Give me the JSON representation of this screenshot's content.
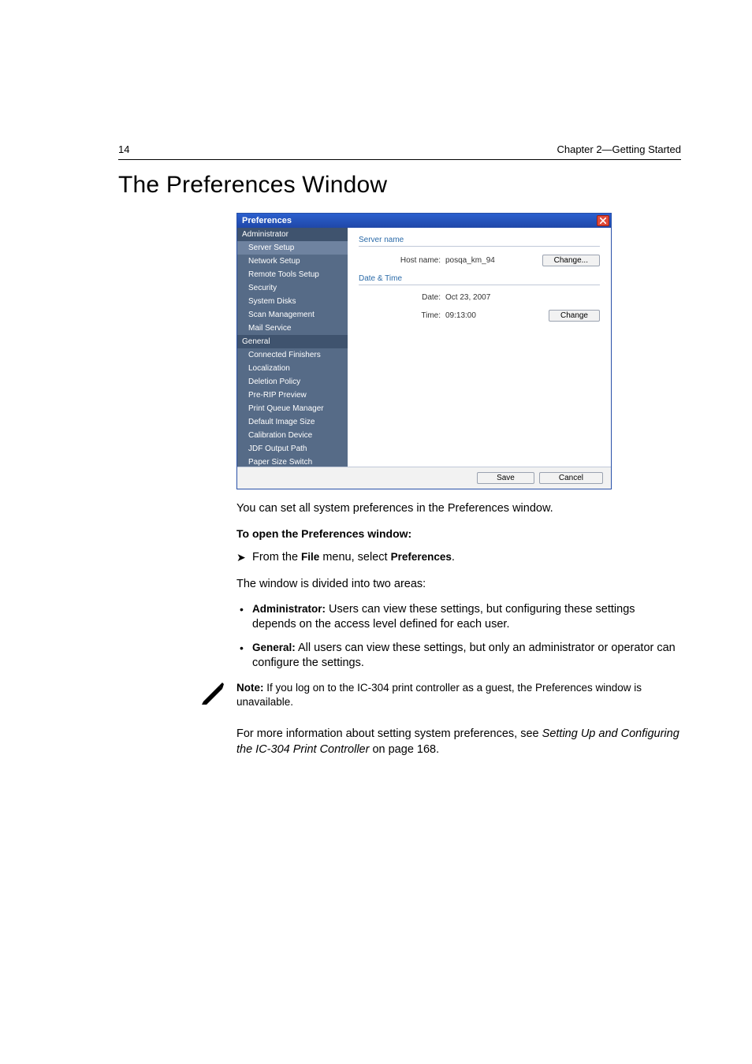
{
  "header": {
    "page_number": "14",
    "chapter": "Chapter 2—Getting Started"
  },
  "title": "The Preferences Window",
  "prefs_window": {
    "title": "Preferences",
    "sidebar": {
      "sections": [
        {
          "head": "Administrator",
          "items": [
            {
              "label": "Server Setup",
              "selected": true
            },
            {
              "label": "Network Setup"
            },
            {
              "label": "Remote Tools Setup"
            },
            {
              "label": "Security"
            },
            {
              "label": "System Disks"
            },
            {
              "label": "Scan Management"
            },
            {
              "label": "Mail Service"
            }
          ]
        },
        {
          "head": "General",
          "items": [
            {
              "label": "Connected Finishers"
            },
            {
              "label": "Localization"
            },
            {
              "label": "Deletion Policy"
            },
            {
              "label": "Pre-RIP Preview"
            },
            {
              "label": "Print Queue Manager"
            },
            {
              "label": "Default Image Size"
            },
            {
              "label": "Calibration Device"
            },
            {
              "label": "JDF Output Path"
            },
            {
              "label": "Paper Size Switch"
            }
          ]
        }
      ]
    },
    "content": {
      "group1": {
        "title": "Server name",
        "hostname_label": "Host name:",
        "hostname_value": "posqa_km_94",
        "change_btn": "Change..."
      },
      "group2": {
        "title": "Date & Time",
        "date_label": "Date:",
        "date_value": "Oct 23, 2007",
        "time_label": "Time:",
        "time_value": "09:13:00",
        "change_btn": "Change"
      }
    },
    "footer": {
      "save": "Save",
      "cancel": "Cancel"
    }
  },
  "body": {
    "p1": "You can set all system preferences in the Preferences window.",
    "h_open": "To open the Preferences window:",
    "step_from": "From the ",
    "step_file": "File",
    "step_mid": " menu, select ",
    "step_pref": "Preferences",
    "step_end": ".",
    "p2": "The window is divided into two areas:",
    "admin_label": "Administrator:",
    "admin_text": " Users can view these settings, but configuring these settings depends on the access level defined for each user.",
    "gen_label": "General:",
    "gen_text": " All users can view these settings, but only an administrator or operator can configure the settings.",
    "note_label": "Note:",
    "note_text": "  If you log on to the IC-304 print controller as a guest, the Preferences window is unavailable.",
    "xref_pre": "For more information about setting system preferences, see ",
    "xref_link": "Setting Up and Configuring the IC-304 Print Controller",
    "xref_post": " on page 168."
  }
}
